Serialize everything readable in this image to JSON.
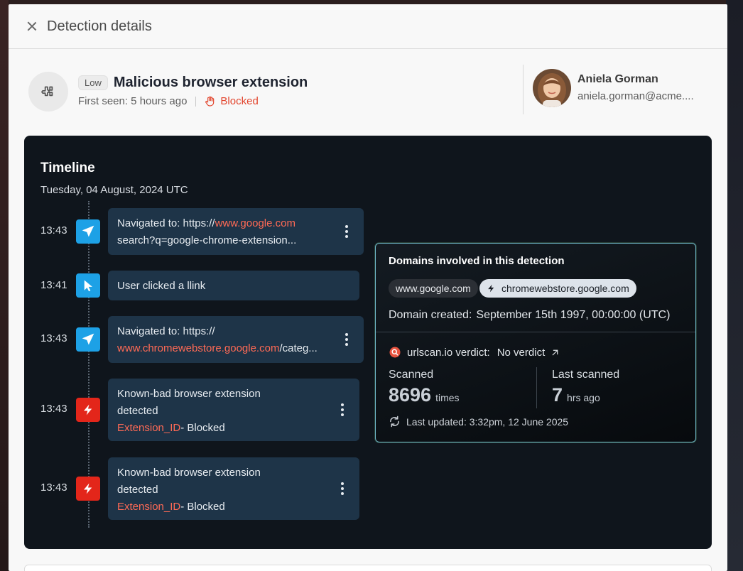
{
  "header": {
    "title": "Detection details"
  },
  "detection": {
    "severity": "Low",
    "title": "Malicious browser extension",
    "first_seen": "First seen: 5 hours ago",
    "status": "Blocked"
  },
  "user": {
    "name": "Aniela Gorman",
    "email": "aniela.gorman@acme...."
  },
  "timeline": {
    "title": "Timeline",
    "date": "Tuesday, 04 August, 2024 UTC",
    "events": [
      {
        "time": "13:43",
        "icon": "navigate-icon",
        "prefix": "Navigated to: https://",
        "link": "www.google.com",
        "line2": "search?q=google-chrome-extension..."
      },
      {
        "time": "13:41",
        "icon": "cursor-icon",
        "text": "User clicked a llink"
      },
      {
        "time": "13:43",
        "icon": "navigate-icon",
        "prefix": "Navigated to: https://",
        "link": "www.chromewebstore.google.com",
        "suffix": "/categ..."
      },
      {
        "time": "13:43",
        "icon": "lightning-icon",
        "line1": "Known-bad browser extension",
        "line2": "detected",
        "id_label": "Extension_ID",
        "status": "- Blocked"
      },
      {
        "time": "13:43",
        "icon": "lightning-icon",
        "line1": "Known-bad browser extension",
        "line2": "detected",
        "id_label": "Extension_ID",
        "status": "- Blocked"
      }
    ]
  },
  "domains_popover": {
    "title": "Domains involved in this detection",
    "domains": [
      "www.google.com",
      "chromewebstore.google.com"
    ],
    "domain_created_label": "Domain created:",
    "domain_created_value": "September 15th 1997, 00:00:00 (UTC)",
    "verdict_label": "urlscan.io verdict:",
    "verdict_value": "No verdict",
    "scanned_label": "Scanned",
    "scanned_count": "8696",
    "scanned_unit": "times",
    "last_scanned_label": "Last scanned",
    "last_scanned_value": "7",
    "last_scanned_unit": "hrs ago",
    "updated": "Last updated: 3:32pm, 12 June 2025"
  },
  "colors": {
    "accent_red": "#e2452d",
    "link_orange": "#ff6a55",
    "event_blue": "#1da1e6",
    "event_red": "#e3261a"
  }
}
